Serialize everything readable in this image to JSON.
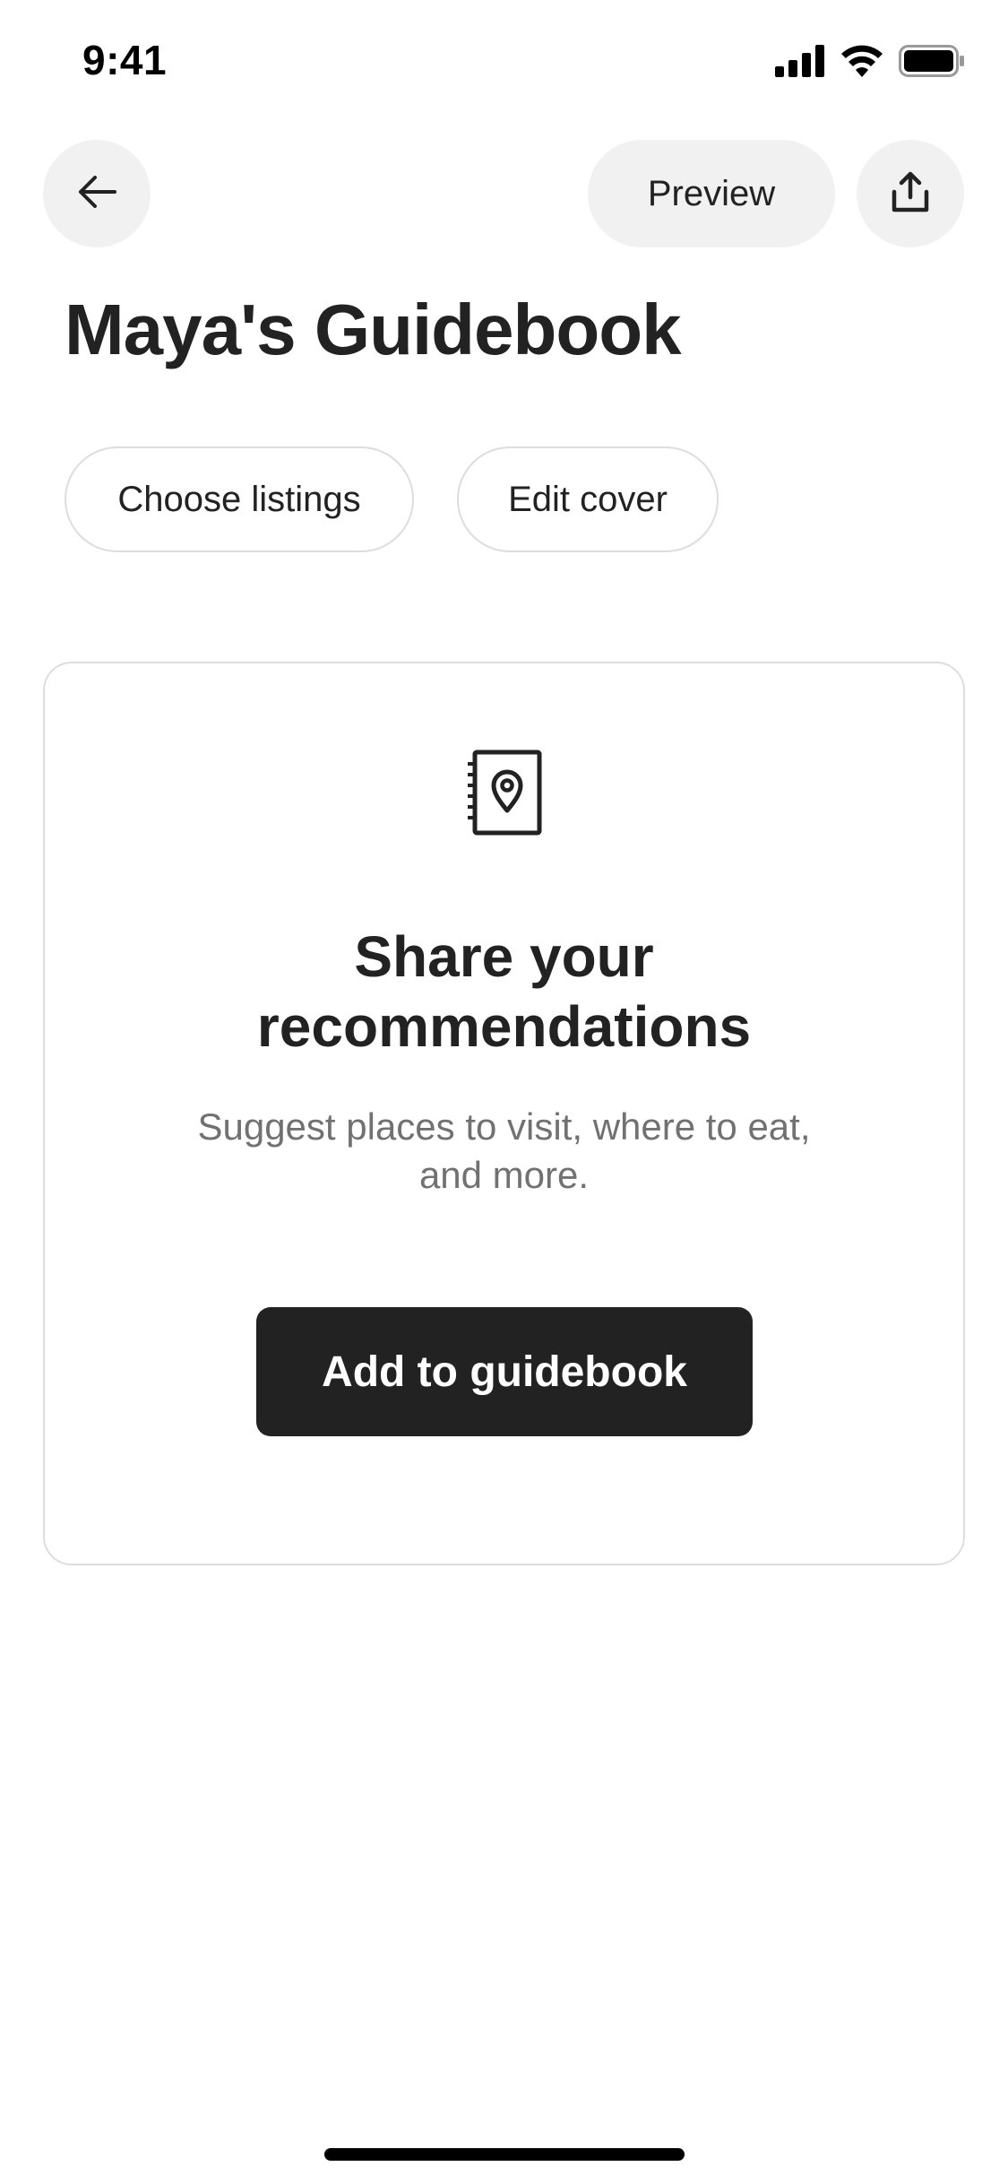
{
  "status_bar": {
    "time": "9:41",
    "icons": [
      "cellular-signal-icon",
      "wifi-icon",
      "battery-icon"
    ]
  },
  "nav": {
    "back_icon": "arrow-left-icon",
    "preview_label": "Preview",
    "share_icon": "share-upload-icon"
  },
  "page": {
    "title": "Maya's Guidebook"
  },
  "chips": {
    "choose_listings": "Choose listings",
    "edit_cover": "Edit cover"
  },
  "card": {
    "icon": "guidebook-location-icon",
    "title": "Share your recommendations",
    "subtitle": "Suggest places to visit, where to eat, and more.",
    "button_label": "Add to guidebook"
  },
  "colors": {
    "text_primary": "#222222",
    "text_secondary": "#717171",
    "button_dark": "#222222",
    "chip_border": "#dddddd",
    "nav_button_bg": "#f1f1f1"
  }
}
